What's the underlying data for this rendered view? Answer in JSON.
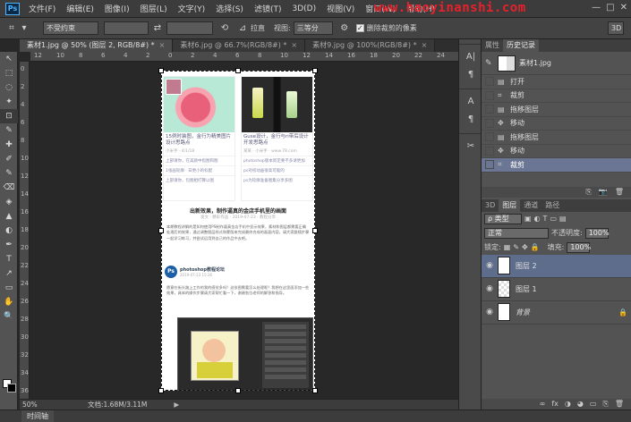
{
  "menubar": {
    "logo": "Ps",
    "items": [
      "文件(F)",
      "编辑(E)",
      "图像(I)",
      "图层(L)",
      "文字(Y)",
      "选择(S)",
      "滤镜(T)",
      "3D(D)",
      "视图(V)",
      "窗口(W)",
      "帮助(H)"
    ],
    "watermark": "www.haoyinanshi.com",
    "window_buttons": [
      "—",
      "□",
      "✕"
    ]
  },
  "options": {
    "ratio": "不受约束",
    "swap_icon": "⇄",
    "straighten": "拉直",
    "view_label": "视图:",
    "view_value": "三等分",
    "delete_cropped": "删除裁剪的像素",
    "mode_3d": "3D"
  },
  "tabs": [
    {
      "label": "素材1.jpg @ 50% (图层 2, RGB/8#) *"
    },
    {
      "label": "素材6.jpg @ 66.7%(RGB/8#) *"
    },
    {
      "label": "素材9.jpg @ 100%(RGB/8#) *"
    }
  ],
  "ruler": {
    "top": [
      "12",
      "10",
      "8",
      "6",
      "4",
      "2",
      "0",
      "2",
      "4",
      "6",
      "8",
      "10",
      "12",
      "14",
      "16",
      "18",
      "20",
      "22",
      "24"
    ],
    "left": [
      "0",
      "2",
      "4",
      "6",
      "8",
      "10",
      "12",
      "14",
      "16",
      "18",
      "20",
      "22",
      "24",
      "26",
      "28",
      "30",
      "32",
      "34",
      "36"
    ]
  },
  "document": {
    "card1_title": "15例时装图，金行为精美图片设计思路点",
    "card1_meta": "小米手 · 4/1/18",
    "card1_lines": [
      "上部请你，在美颜中指图和图",
      "1张画轮廓 · 日更小的标配",
      "上部请你，包图相打算以图"
    ],
    "card2_title": "Guse设计，金行与ri带后设计开发思路点",
    "card2_meta": "某某 · 小米手 · www.78.com",
    "card2_lines": [
      "photoshop版本新定要不多请更加",
      "ps对初动画很高可能的",
      "ps为轮廓准备图集分享多图"
    ],
    "article_title": "出新效果，制作逼真的金店手机里的画面",
    "article_sub": "发文 · 精彩作品 · 2019-07-23 · 教程分享",
    "article_body": "本期教程讲解的是如何使用PS制作逼真金店手机中显示效果，素材和图层都需要正确处理后的效果，通过调整图层样式和蒙版来完成最终合成的画面内容，请大家跟随步骤一起学习练习，并尝试运用到自己的作品中去吧。",
    "post_avatar": "Ps",
    "post_name": "photoshop教程论坛",
    "post_date": "2019-07-23 15:26",
    "post_text": "愿意在街头路上工作的我的感觉多吗？这张图需要怎么处理呢？我想在这里面添加一些效果，具体的操作步骤请大家帮忙看一下，谢谢各位老师的解答和指导。"
  },
  "tools": [
    "↖",
    "⬚",
    "◌",
    "✦",
    "⊡",
    "✎",
    "✚",
    "✐",
    "✎",
    "⌫",
    "◈",
    "▲",
    "◐",
    "✒",
    "T",
    "↗",
    "▭",
    "✋",
    "🔍"
  ],
  "status": {
    "zoom": "50%",
    "doc_info": "文档:1.68M/3.11M",
    "arrow": "▶"
  },
  "timeline": "时间轴",
  "dock": [
    "A|",
    "¶",
    "A",
    "¶",
    "✂"
  ],
  "history": {
    "tabs": [
      "属性",
      "历史记录"
    ],
    "snapshot": "素材1.jpg",
    "items": [
      {
        "icon": "▤",
        "label": "打开"
      },
      {
        "icon": "⌗",
        "label": "裁剪"
      },
      {
        "icon": "▤",
        "label": "拖移图层"
      },
      {
        "icon": "✥",
        "label": "移动"
      },
      {
        "icon": "▤",
        "label": "拖移图层"
      },
      {
        "icon": "✥",
        "label": "移动"
      },
      {
        "icon": "⌗",
        "label": "裁剪"
      }
    ],
    "footer_icons": [
      "⎘",
      "📷",
      "🗑"
    ]
  },
  "layers": {
    "tabs": [
      "3D",
      "图层",
      "通道",
      "路径"
    ],
    "kind_label": "ρ 类型",
    "blend_mode": "正常",
    "opacity_label": "不透明度:",
    "opacity_value": "100%",
    "lock_label": "锁定:",
    "fill_label": "填充:",
    "fill_value": "100%",
    "items": [
      {
        "name": "图层 2",
        "eye": "◉",
        "lock": ""
      },
      {
        "name": "图层 1",
        "eye": "◉",
        "lock": ""
      },
      {
        "name": "背景",
        "eye": "◉",
        "lock": "🔒"
      }
    ],
    "footer_icons": [
      "∞",
      "fx",
      "◑",
      "◕",
      "▭",
      "⎘",
      "🗑"
    ]
  }
}
